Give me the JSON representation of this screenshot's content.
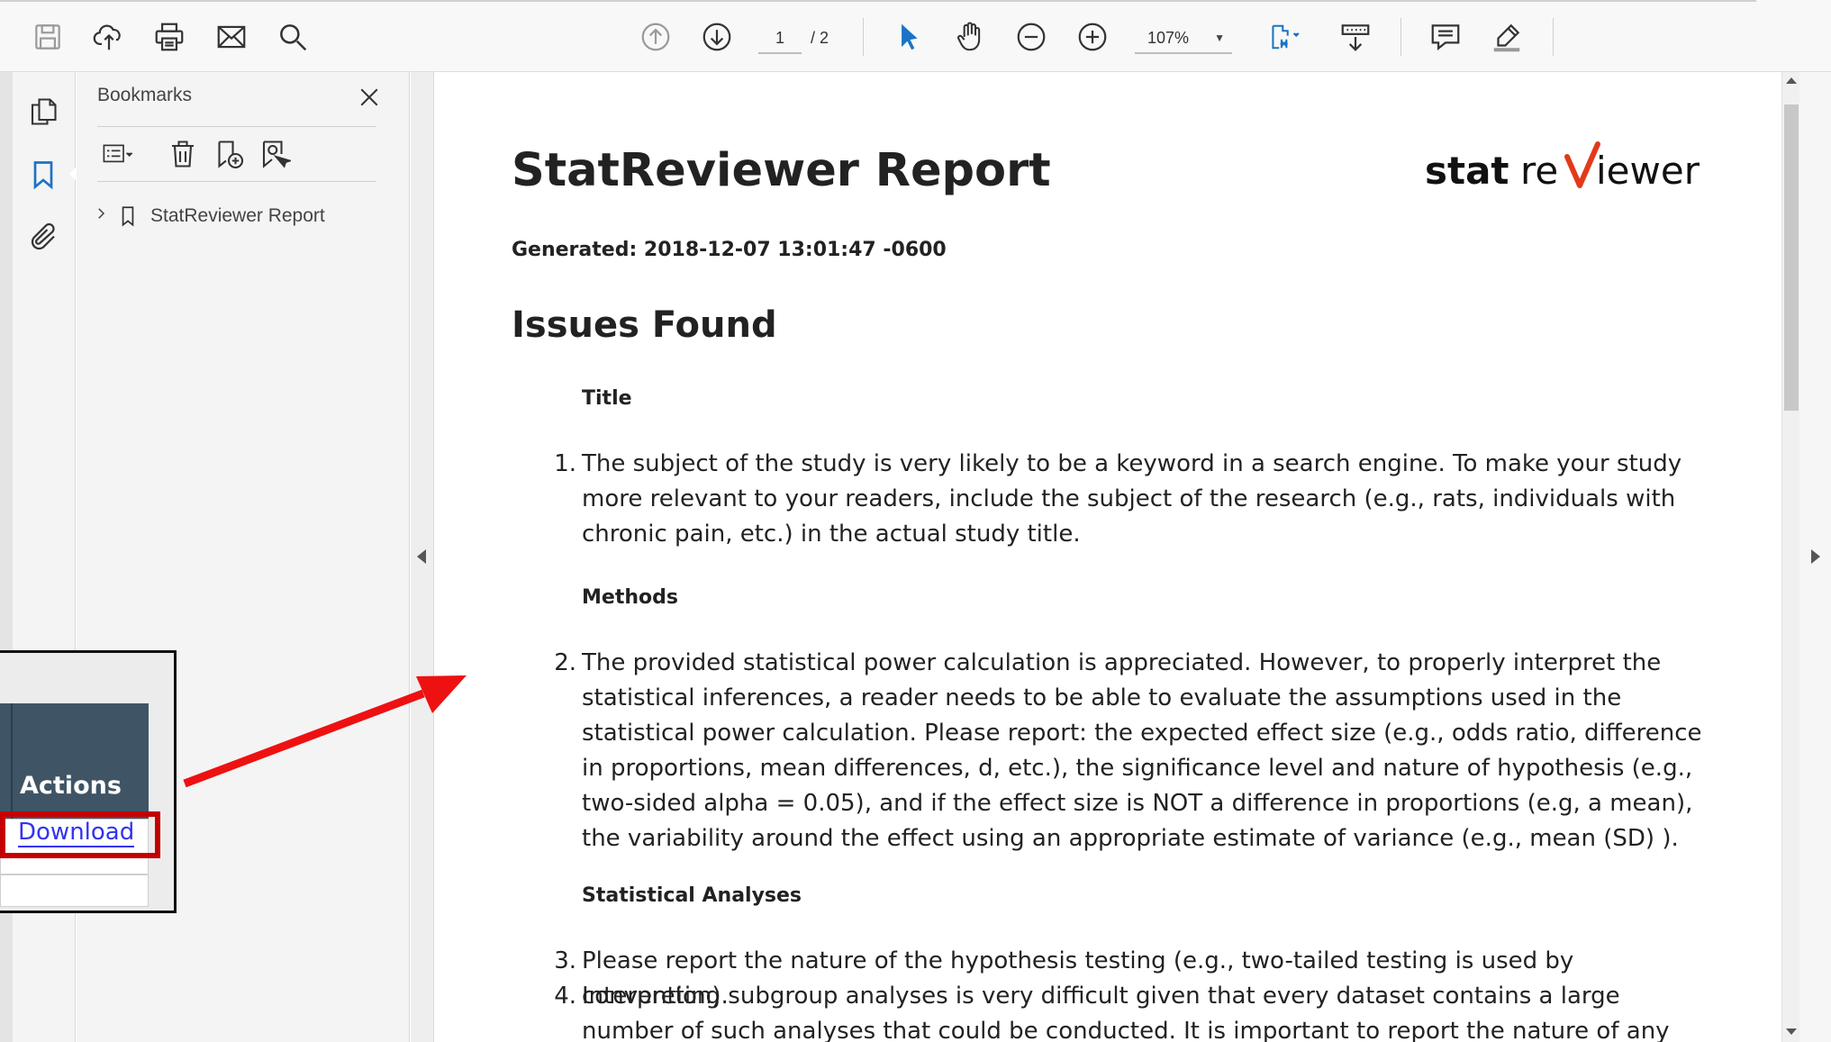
{
  "toolbar": {
    "current_page": "1",
    "page_total": "/ 2",
    "zoom": "107%"
  },
  "bookmarks": {
    "title": "Bookmarks",
    "items": [
      {
        "label": "StatReviewer Report"
      }
    ]
  },
  "document": {
    "title": "StatReviewer Report",
    "logo_text": {
      "part1": "stat",
      "part2": "re",
      "part3": "iewer"
    },
    "generated": "Generated: 2018-12-07 13:01:47 -0600",
    "heading": "Issues Found",
    "sections": [
      {
        "name": "Title"
      },
      {
        "name": "Methods"
      },
      {
        "name": "Statistical Analyses"
      }
    ],
    "items": [
      {
        "num": "1.",
        "text": "The subject of the study is very likely to be a keyword in a search engine. To make your study more relevant to your readers, include the subject of the research (e.g., rats, individuals with chronic pain, etc.) in the actual study title."
      },
      {
        "num": "2.",
        "text": "The provided statistical power calculation is appreciated. However, to properly interpret the statistical inferences, a reader needs to be able to evaluate the assumptions used in the statistical power calculation. Please report: the expected effect size (e.g., odds ratio, difference in proportions, mean differences, d, etc.), the significance level and nature of hypothesis (e.g., two-sided alpha = 0.05), and if the effect size is NOT a difference in proportions (e.g, a mean), the variability around the effect using an appropriate estimate of variance (e.g., mean (SD) )."
      },
      {
        "num": "3.",
        "text": "Please report the nature of the hypothesis testing (e.g., two-tailed testing is used by convention)."
      },
      {
        "num": "4.",
        "text": "Interpreting subgroup analyses is very difficult given that every dataset contains a large number of such analyses that could be conducted. It is important to report the nature of any subgroup"
      }
    ]
  },
  "inset": {
    "header": "Actions",
    "link": "Download"
  },
  "colors": {
    "accent": "#1a73c7",
    "inset_header": "#3f5566",
    "highlight_box": "#c40000",
    "arrow": "#ee1111",
    "link": "#3333ee"
  }
}
